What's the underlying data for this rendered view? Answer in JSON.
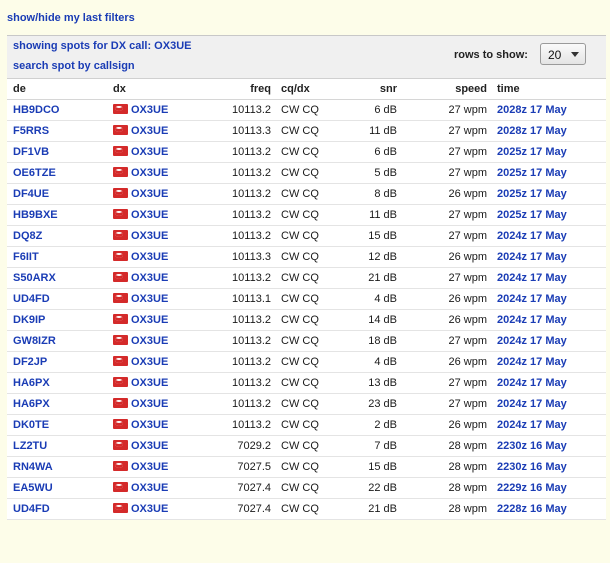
{
  "top_link": "show/hide my last filters",
  "header": {
    "showing_text": "showing spots for DX call: OX3UE",
    "search_link": "search spot by callsign",
    "rows_label": "rows to show:",
    "rows_value": "20"
  },
  "columns": [
    "de",
    "dx",
    "freq",
    "cq/dx",
    "snr",
    "speed",
    "time"
  ],
  "flag_icon": "greenland-flag-icon",
  "rows": [
    {
      "de": "HB9DCO",
      "dx": "OX3UE",
      "freq": "10113.2",
      "cq": "CW CQ",
      "snr": "6 dB",
      "speed": "27 wpm",
      "time": "2028z 17 May"
    },
    {
      "de": "F5RRS",
      "dx": "OX3UE",
      "freq": "10113.3",
      "cq": "CW CQ",
      "snr": "11 dB",
      "speed": "27 wpm",
      "time": "2028z 17 May"
    },
    {
      "de": "DF1VB",
      "dx": "OX3UE",
      "freq": "10113.2",
      "cq": "CW CQ",
      "snr": "6 dB",
      "speed": "27 wpm",
      "time": "2025z 17 May"
    },
    {
      "de": "OE6TZE",
      "dx": "OX3UE",
      "freq": "10113.2",
      "cq": "CW CQ",
      "snr": "5 dB",
      "speed": "27 wpm",
      "time": "2025z 17 May"
    },
    {
      "de": "DF4UE",
      "dx": "OX3UE",
      "freq": "10113.2",
      "cq": "CW CQ",
      "snr": "8 dB",
      "speed": "26 wpm",
      "time": "2025z 17 May"
    },
    {
      "de": "HB9BXE",
      "dx": "OX3UE",
      "freq": "10113.2",
      "cq": "CW CQ",
      "snr": "11 dB",
      "speed": "27 wpm",
      "time": "2025z 17 May"
    },
    {
      "de": "DQ8Z",
      "dx": "OX3UE",
      "freq": "10113.2",
      "cq": "CW CQ",
      "snr": "15 dB",
      "speed": "27 wpm",
      "time": "2024z 17 May"
    },
    {
      "de": "F6IIT",
      "dx": "OX3UE",
      "freq": "10113.3",
      "cq": "CW CQ",
      "snr": "12 dB",
      "speed": "26 wpm",
      "time": "2024z 17 May"
    },
    {
      "de": "S50ARX",
      "dx": "OX3UE",
      "freq": "10113.2",
      "cq": "CW CQ",
      "snr": "21 dB",
      "speed": "27 wpm",
      "time": "2024z 17 May"
    },
    {
      "de": "UD4FD",
      "dx": "OX3UE",
      "freq": "10113.1",
      "cq": "CW CQ",
      "snr": "4 dB",
      "speed": "26 wpm",
      "time": "2024z 17 May"
    },
    {
      "de": "DK9IP",
      "dx": "OX3UE",
      "freq": "10113.2",
      "cq": "CW CQ",
      "snr": "14 dB",
      "speed": "26 wpm",
      "time": "2024z 17 May"
    },
    {
      "de": "GW8IZR",
      "dx": "OX3UE",
      "freq": "10113.2",
      "cq": "CW CQ",
      "snr": "18 dB",
      "speed": "27 wpm",
      "time": "2024z 17 May"
    },
    {
      "de": "DF2JP",
      "dx": "OX3UE",
      "freq": "10113.2",
      "cq": "CW CQ",
      "snr": "4 dB",
      "speed": "26 wpm",
      "time": "2024z 17 May"
    },
    {
      "de": "HA6PX",
      "dx": "OX3UE",
      "freq": "10113.2",
      "cq": "CW CQ",
      "snr": "13 dB",
      "speed": "27 wpm",
      "time": "2024z 17 May"
    },
    {
      "de": "HA6PX",
      "dx": "OX3UE",
      "freq": "10113.2",
      "cq": "CW CQ",
      "snr": "23 dB",
      "speed": "27 wpm",
      "time": "2024z 17 May"
    },
    {
      "de": "DK0TE",
      "dx": "OX3UE",
      "freq": "10113.2",
      "cq": "CW CQ",
      "snr": "2 dB",
      "speed": "26 wpm",
      "time": "2024z 17 May"
    },
    {
      "de": "LZ2TU",
      "dx": "OX3UE",
      "freq": "7029.2",
      "cq": "CW CQ",
      "snr": "7 dB",
      "speed": "28 wpm",
      "time": "2230z 16 May"
    },
    {
      "de": "RN4WA",
      "dx": "OX3UE",
      "freq": "7027.5",
      "cq": "CW CQ",
      "snr": "15 dB",
      "speed": "28 wpm",
      "time": "2230z 16 May"
    },
    {
      "de": "EA5WU",
      "dx": "OX3UE",
      "freq": "7027.4",
      "cq": "CW CQ",
      "snr": "22 dB",
      "speed": "28 wpm",
      "time": "2229z 16 May"
    },
    {
      "de": "UD4FD",
      "dx": "OX3UE",
      "freq": "7027.4",
      "cq": "CW CQ",
      "snr": "21 dB",
      "speed": "28 wpm",
      "time": "2228z 16 May"
    }
  ]
}
